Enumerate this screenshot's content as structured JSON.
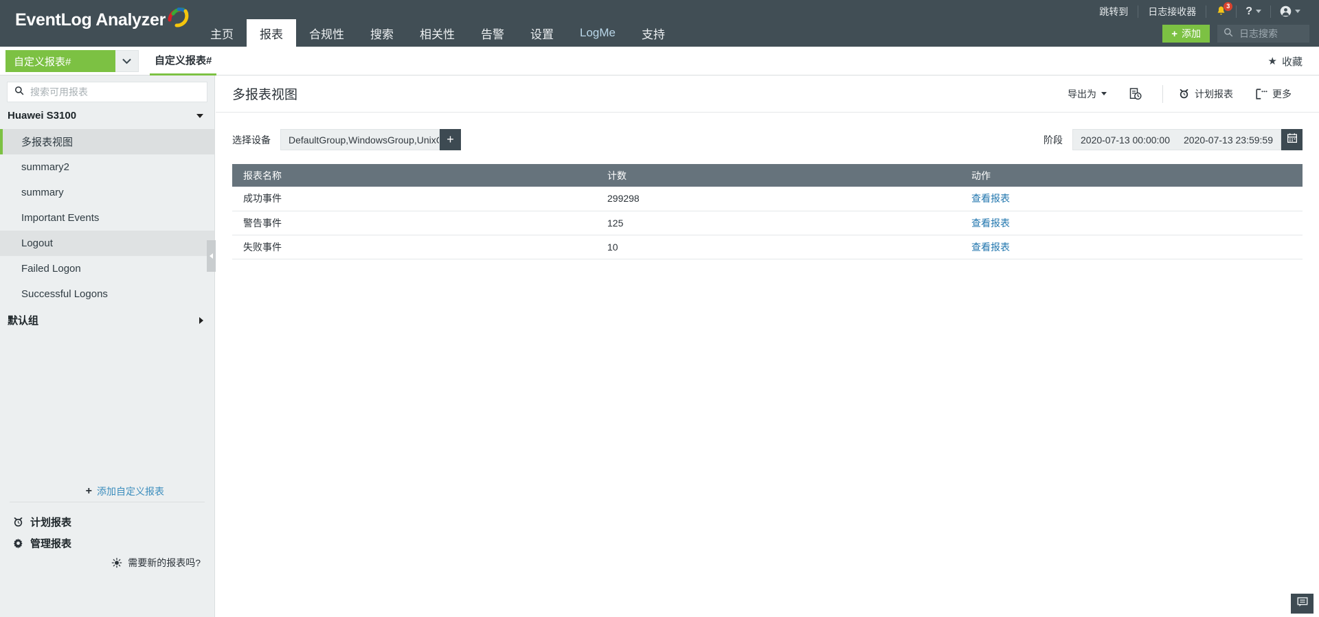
{
  "app": {
    "logo_text": "EventLog Analyzer",
    "logo_icon": "swoosh-logo"
  },
  "topnav": {
    "items": [
      {
        "label": "主页",
        "active": false
      },
      {
        "label": "报表",
        "active": true
      },
      {
        "label": "合规性",
        "active": false
      },
      {
        "label": "搜索",
        "active": false
      },
      {
        "label": "相关性",
        "active": false
      },
      {
        "label": "告警",
        "active": false
      },
      {
        "label": "设置",
        "active": false
      },
      {
        "label": "LogMe",
        "active": false
      },
      {
        "label": "支持",
        "active": false
      }
    ]
  },
  "topright": {
    "jump_to": "跳转到",
    "log_receiver": "日志接收器",
    "notification_count": "3",
    "help_label": "?",
    "add_button": "添加",
    "search_placeholder": "日志搜索"
  },
  "subbar": {
    "report_select_value": "自定义报表#",
    "breadcrumb_tab": "自定义报表#",
    "favorite_label": "收藏"
  },
  "sidebar": {
    "search_placeholder": "搜索可用报表",
    "groups": [
      {
        "label": "Huawei S3100",
        "expanded": true
      },
      {
        "label": "默认组",
        "expanded": false
      }
    ],
    "items": [
      {
        "label": "多报表视图",
        "state": "selected"
      },
      {
        "label": "summary2",
        "state": "normal"
      },
      {
        "label": "summary",
        "state": "normal"
      },
      {
        "label": "Important Events",
        "state": "normal"
      },
      {
        "label": "Logout",
        "state": "hovered"
      },
      {
        "label": "Failed Logon",
        "state": "normal"
      },
      {
        "label": "Successful Logons",
        "state": "normal"
      }
    ],
    "add_custom_report": "添加自定义报表",
    "actions": [
      {
        "label": "计划报表",
        "icon": "alarm-clock-icon"
      },
      {
        "label": "管理报表",
        "icon": "gear-icon"
      }
    ],
    "need_report": "需要新的报表吗?"
  },
  "main": {
    "title": "多报表视图",
    "tools": [
      {
        "label": "导出为",
        "icon": "export-icon",
        "has_caret": true
      },
      {
        "label": "",
        "icon": "report-clock-icon",
        "has_caret": false
      },
      {
        "label": "计划报表",
        "icon": "alarm-clock-icon",
        "has_caret": false
      },
      {
        "label": "更多",
        "icon": "more-icon",
        "has_caret": false
      }
    ],
    "filters": {
      "device_label": "选择设备",
      "device_value": "DefaultGroup,WindowsGroup,UnixGro",
      "add_device_icon": "plus-icon",
      "period_label": "阶段",
      "period_from": "2020-07-13 00:00:00",
      "period_to": "2020-07-13 23:59:59",
      "calendar_icon": "calendar-icon"
    },
    "table": {
      "columns": [
        "报表名称",
        "计数",
        "动作"
      ],
      "rows": [
        {
          "name": "成功事件",
          "count": "299298",
          "action": "查看报表"
        },
        {
          "name": "警告事件",
          "count": "125",
          "action": "查看报表"
        },
        {
          "name": "失败事件",
          "count": "10",
          "action": "查看报表"
        }
      ]
    }
  },
  "footer": {
    "chat_icon": "chat-icon"
  },
  "colors": {
    "header_bg": "#414e55",
    "accent_green": "#7cc143",
    "link_blue": "#2176ae",
    "table_header": "#66737c",
    "badge_red": "#d9432f"
  }
}
